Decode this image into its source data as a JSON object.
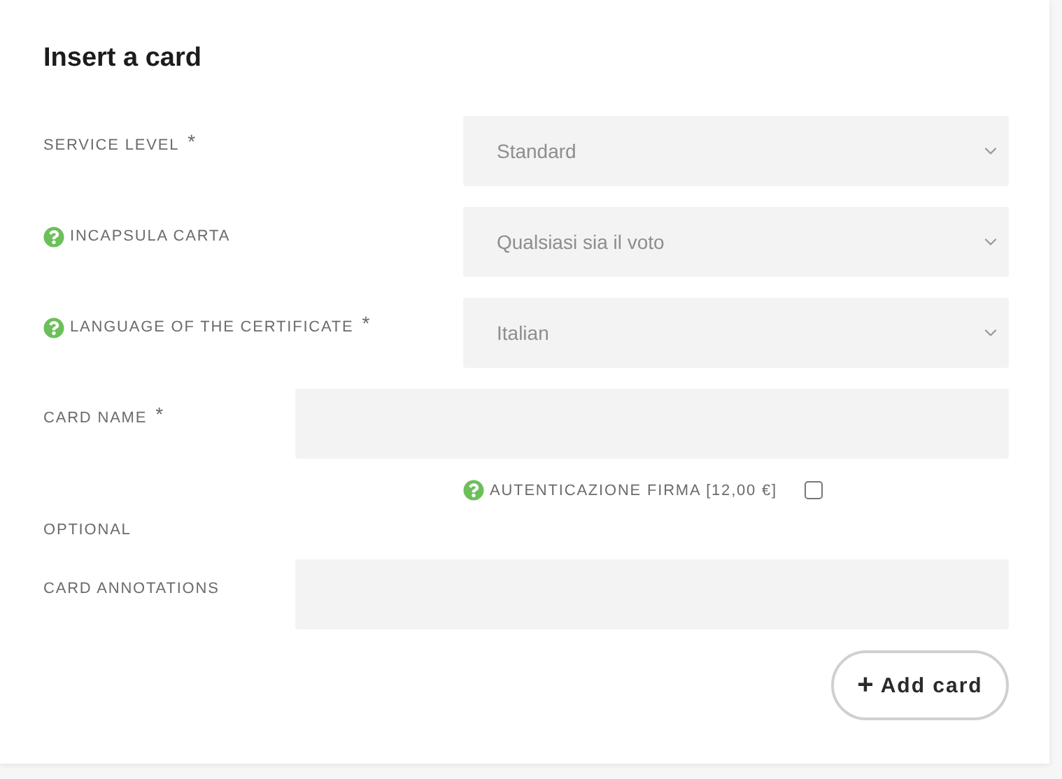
{
  "title": "Insert a card",
  "fields": [
    {
      "kind": "select",
      "label": "SERVICE LEVEL",
      "required": "*",
      "help": false,
      "value": "Standard"
    },
    {
      "kind": "select",
      "label": "INCAPSULA CARTA",
      "help": true,
      "value": "Qualsiasi sia il voto"
    },
    {
      "kind": "select",
      "label": "LANGUAGE OF THE CERTIFICATE",
      "required": "*",
      "help": true,
      "value": "Italian"
    },
    {
      "kind": "text",
      "label": "CARD NAME",
      "required": "*",
      "help": false
    },
    {
      "kind": "checkbox",
      "label": "OPTIONAL",
      "help": false,
      "option": {
        "label": "AUTENTICAZIONE FIRMA [12,00 €]",
        "help": true,
        "checked": false
      }
    },
    {
      "kind": "text",
      "label": "CARD ANNOTATIONS",
      "help": false
    }
  ],
  "button": {
    "icon": "+",
    "label": "Add card"
  }
}
